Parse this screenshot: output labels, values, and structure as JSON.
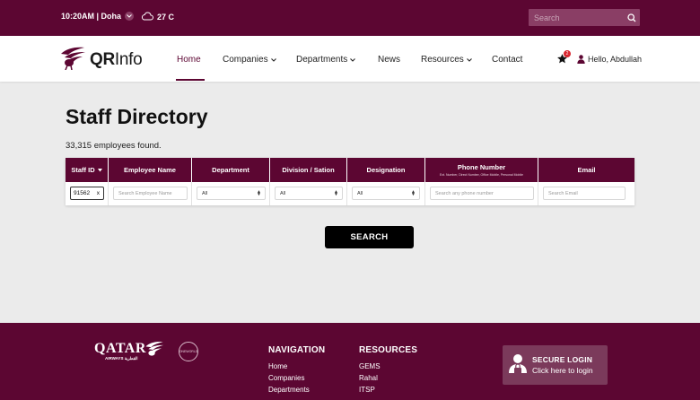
{
  "topbar": {
    "time_location": "10:20AM | Doha",
    "temperature": "27 C",
    "search_placeholder": "Search"
  },
  "brand": {
    "logo_bold": "QR",
    "logo_rest": "Info"
  },
  "nav": {
    "items": [
      {
        "label": "Home",
        "active": true,
        "dropdown": false
      },
      {
        "label": "Companies",
        "dropdown": true
      },
      {
        "label": "Departments",
        "dropdown": true
      },
      {
        "label": "News",
        "dropdown": false
      },
      {
        "label": "Resources",
        "dropdown": true
      },
      {
        "label": "Contact",
        "dropdown": false
      }
    ],
    "favorites_badge": "2",
    "greeting": "Hello, Abdullah"
  },
  "main": {
    "title": "Staff Directory",
    "count_text": "33,315 employees found.",
    "table": {
      "headers": [
        {
          "label": "Staff ID",
          "sortable": true
        },
        {
          "label": "Employee Name"
        },
        {
          "label": "Department"
        },
        {
          "label": "Division / Sation"
        },
        {
          "label": "Designation"
        },
        {
          "label": "Phone Number",
          "sub": "Ext. Number, Direct Number, Office Mobile, Personal Mobile"
        },
        {
          "label": "Email"
        }
      ],
      "filters": {
        "staff_id_value": "91562",
        "staff_id_clear": "x",
        "employee_name_placeholder": "Search Employee Name",
        "department_value": "All",
        "division_value": "All",
        "designation_value": "All",
        "phone_placeholder": "Search any phone number",
        "email_placeholder": "Search Email"
      }
    },
    "search_button": "SEARCH"
  },
  "footer": {
    "brand_word": "QATAR",
    "brand_sub": "AIRWAYS القطرية",
    "alliance": "ONEWORLD",
    "navigation": {
      "heading": "NAVIGATION",
      "links": [
        "Home",
        "Companies",
        "Departments"
      ]
    },
    "resources": {
      "heading": "RESOURCES",
      "links": [
        "GEMS",
        "Rahal",
        "ITSP"
      ]
    },
    "secure_login": {
      "title": "SECURE LOGIN",
      "subtitle": "Click here to login"
    }
  },
  "colors": {
    "brand": "#5c0632",
    "brand_light": "#8a3e65",
    "button": "#000000",
    "badge": "#d8262f"
  }
}
